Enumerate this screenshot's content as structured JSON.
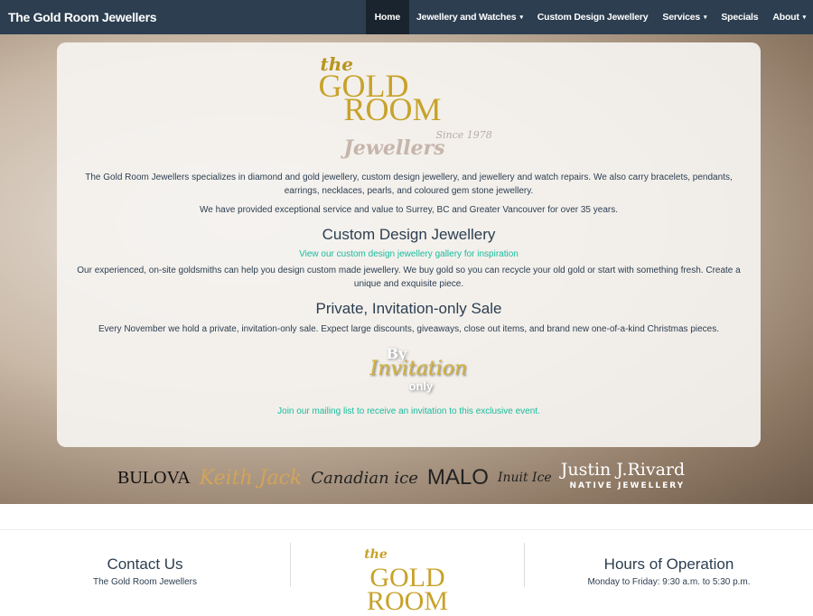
{
  "nav": {
    "brand": "The Gold Room Jewellers",
    "items": [
      {
        "label": "Home",
        "caret": false
      },
      {
        "label": "Jewellery and Watches",
        "caret": true
      },
      {
        "label": "Custom Design Jewellery",
        "caret": false
      },
      {
        "label": "Services",
        "caret": true
      },
      {
        "label": "Specials",
        "caret": false
      },
      {
        "label": "About",
        "caret": true
      }
    ],
    "caret": "▾"
  },
  "logo": {
    "the": "the",
    "gold": "GOLD",
    "room": "ROOM",
    "jewellers": "Jewellers",
    "since": "Since 1978"
  },
  "intro": {
    "p1": "The Gold Room Jewellers specializes in diamond and gold jewellery, custom design jewellery, and jewellery and watch repairs. We also carry bracelets, pendants, earrings, necklaces, pearls, and coloured gem stone jewellery.",
    "p2": "We have provided exceptional service and value to Surrey, BC and Greater Vancouver for over 35 years."
  },
  "custom": {
    "heading": "Custom Design Jewellery",
    "link": "View our custom design jewellery gallery for inspiration",
    "text": "Our experienced, on-site goldsmiths can help you design custom made jewellery. We buy gold so you can recycle your old gold or start with something fresh. Create a unique and exquisite piece."
  },
  "sale": {
    "heading": "Private, Invitation-only Sale",
    "text": "Every November we hold a private, invitation-only sale. Expect large discounts, giveaways, close out items, and brand new one-of-a-kind Christmas pieces.",
    "badge": {
      "by": "By",
      "invitation": "Invitation",
      "only": "only"
    },
    "link": "Join our mailing list to receive an invitation to this exclusive event."
  },
  "brands": [
    "BULOVA",
    "Keith Jack",
    "Canadian ice",
    "MALO",
    "Inuit Ice",
    "Justin J.Rivard",
    "NATIVE JEWELLERY"
  ],
  "footer": {
    "contact": {
      "heading": "Contact Us",
      "line1": "The Gold Room Jewellers"
    },
    "hours": {
      "heading": "Hours of Operation",
      "line1": "Monday to Friday: 9:30 a.m. to 5:30 p.m."
    },
    "logo": {
      "the": "the",
      "gold": "GOLD",
      "room": "ROOM"
    }
  }
}
